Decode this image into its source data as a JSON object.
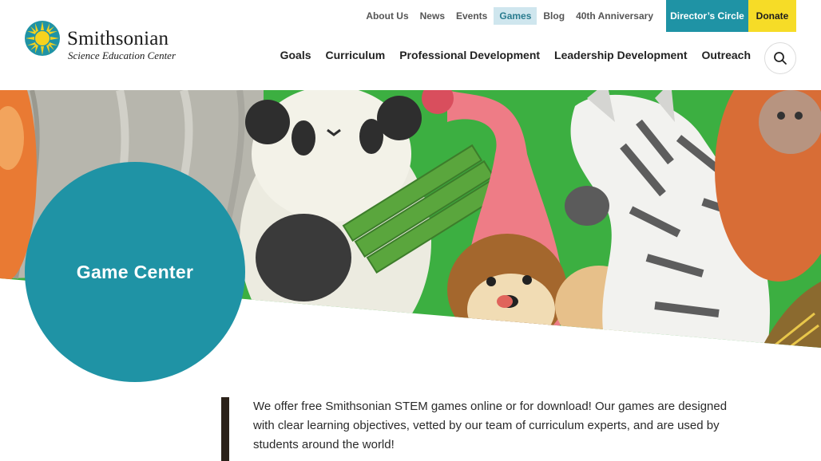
{
  "logo": {
    "name": "Smithsonian",
    "subtitle": "Science Education Center",
    "icon": "sun-logo-icon",
    "sun_color": "#f6d21e",
    "ring_color": "#1f93a5"
  },
  "utility_nav": {
    "links": [
      "About Us",
      "News",
      "Events",
      "Games",
      "Blog",
      "40th Anniversary"
    ],
    "active": "Games",
    "directors_circle": "Director’s Circle",
    "donate": "Donate"
  },
  "main_nav": {
    "links": [
      "Goals",
      "Curriculum",
      "Professional Development",
      "Leadership Development",
      "Outreach"
    ],
    "search_icon": "search-icon"
  },
  "hero": {
    "title": "Game Center",
    "image": "cartoon-animals-illustration"
  },
  "intro": {
    "text": "We offer free Smithsonian STEM games online or for download! Our games are designed with clear learning objectives, vetted by our team of curriculum experts, and are used by students around the world!"
  },
  "colors": {
    "teal": "#1f93a5",
    "donate_yellow": "#f6dc27",
    "active_tab_bg": "#cfe6ee",
    "hero_green": "#3caf41",
    "quote_bar": "#2b2119"
  }
}
